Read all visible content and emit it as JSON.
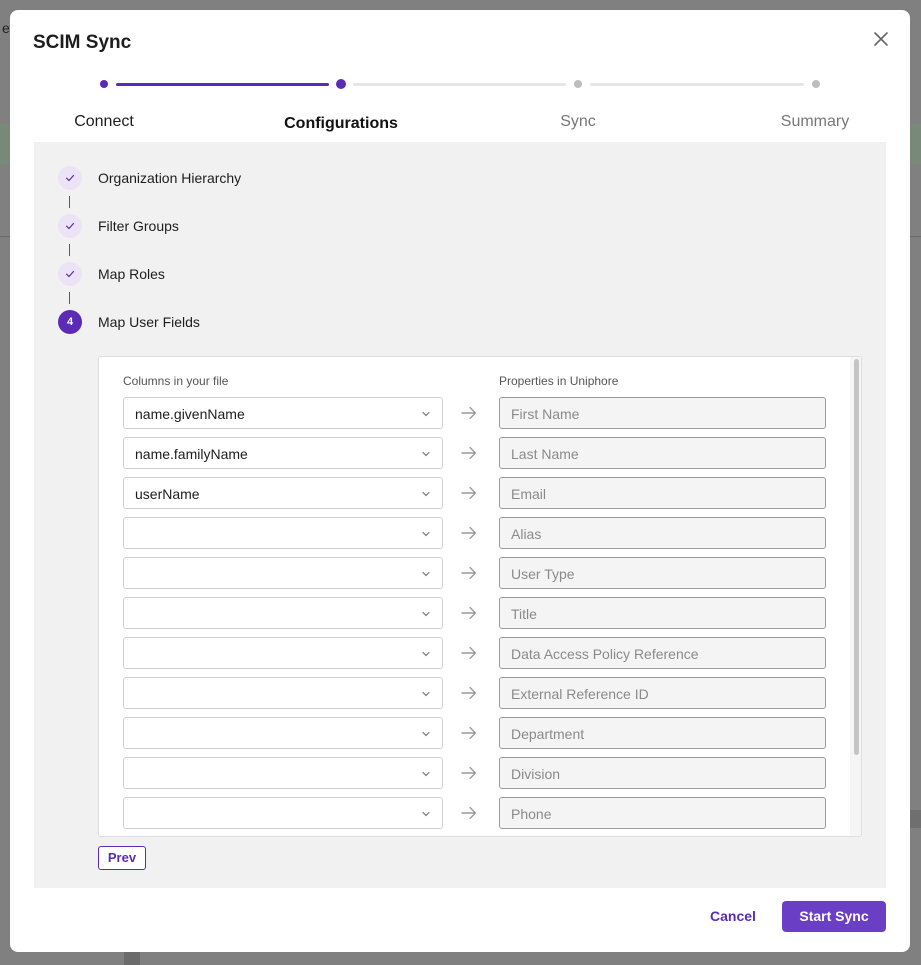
{
  "modal": {
    "title": "SCIM Sync",
    "close_icon": "close-icon"
  },
  "stepper": {
    "steps": [
      {
        "label": "Connect",
        "state": "done"
      },
      {
        "label": "Configurations",
        "state": "active"
      },
      {
        "label": "Sync",
        "state": "todo"
      },
      {
        "label": "Summary",
        "state": "todo"
      }
    ]
  },
  "substeps": [
    {
      "label": "Organization Hierarchy",
      "state": "done",
      "icon": "check-icon"
    },
    {
      "label": "Filter Groups",
      "state": "done",
      "icon": "check-icon"
    },
    {
      "label": "Map Roles",
      "state": "done",
      "icon": "check-icon"
    },
    {
      "label": "Map User Fields",
      "state": "current",
      "number": "4"
    }
  ],
  "mapping": {
    "left_header": "Columns in your file",
    "right_header": "Properties in Uniphore",
    "rows": [
      {
        "column": "name.givenName",
        "property": "First Name"
      },
      {
        "column": "name.familyName",
        "property": "Last Name"
      },
      {
        "column": "userName",
        "property": "Email"
      },
      {
        "column": "",
        "property": "Alias"
      },
      {
        "column": "",
        "property": "User Type"
      },
      {
        "column": "",
        "property": "Title"
      },
      {
        "column": "",
        "property": "Data Access Policy Reference"
      },
      {
        "column": "",
        "property": "External Reference ID"
      },
      {
        "column": "",
        "property": "Department"
      },
      {
        "column": "",
        "property": "Division"
      },
      {
        "column": "",
        "property": "Phone"
      }
    ]
  },
  "buttons": {
    "prev": "Prev",
    "cancel": "Cancel",
    "start_sync": "Start Sync"
  },
  "colors": {
    "accent": "#5b2bb5",
    "primary_button": "#6a3fc3",
    "content_bg": "#f1f1f1",
    "overlay": "#808080"
  },
  "background": {
    "partial_letter": "e"
  }
}
